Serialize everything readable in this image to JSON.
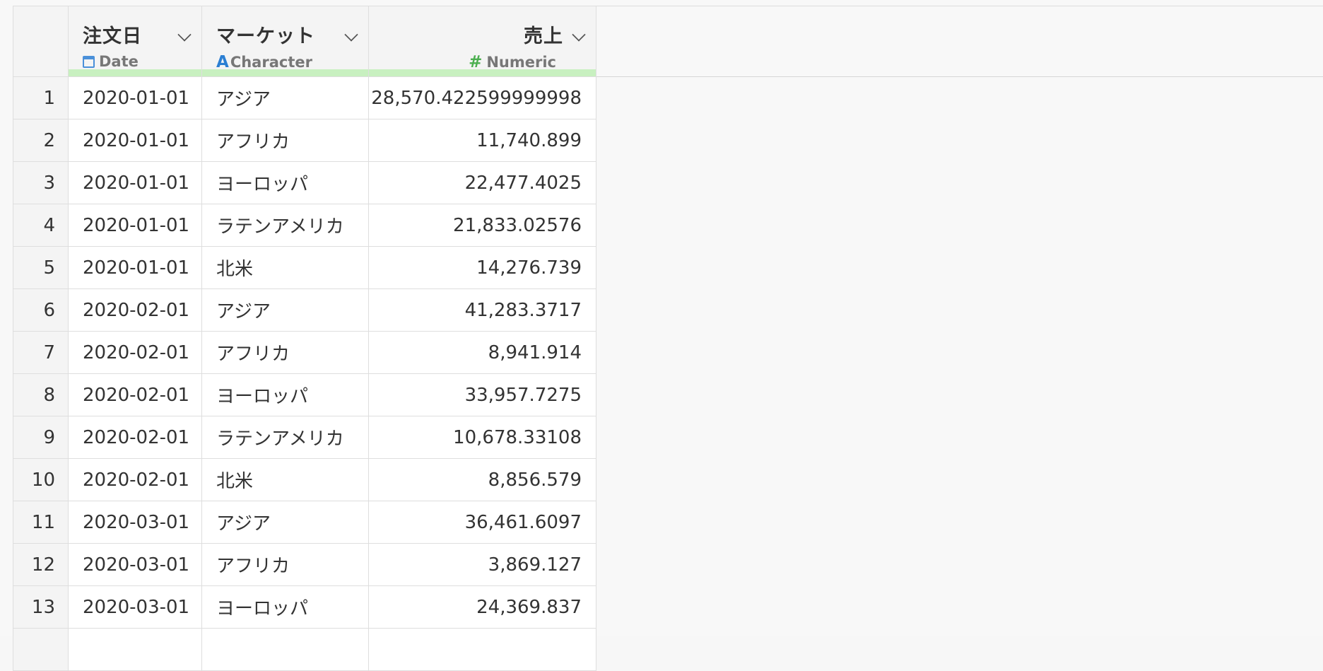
{
  "columns": [
    {
      "name": "注文日",
      "type_label": "Date",
      "type_icon": "calendar-icon"
    },
    {
      "name": "マーケット",
      "type_label": "Character",
      "type_icon": "character-a-icon"
    },
    {
      "name": "売上",
      "type_label": "Numeric",
      "type_icon": "hash-icon"
    }
  ],
  "type_icon_glyphs": {
    "character": "A",
    "numeric": "#"
  },
  "rows": [
    {
      "n": "1",
      "date": "2020-01-01",
      "market": "アジア",
      "sales": "28,570.422599999998"
    },
    {
      "n": "2",
      "date": "2020-01-01",
      "market": "アフリカ",
      "sales": "11,740.899"
    },
    {
      "n": "3",
      "date": "2020-01-01",
      "market": "ヨーロッパ",
      "sales": "22,477.4025"
    },
    {
      "n": "4",
      "date": "2020-01-01",
      "market": "ラテンアメリカ",
      "sales": "21,833.02576"
    },
    {
      "n": "5",
      "date": "2020-01-01",
      "market": "北米",
      "sales": "14,276.739"
    },
    {
      "n": "6",
      "date": "2020-02-01",
      "market": "アジア",
      "sales": "41,283.3717"
    },
    {
      "n": "7",
      "date": "2020-02-01",
      "market": "アフリカ",
      "sales": "8,941.914"
    },
    {
      "n": "8",
      "date": "2020-02-01",
      "market": "ヨーロッパ",
      "sales": "33,957.7275"
    },
    {
      "n": "9",
      "date": "2020-02-01",
      "market": "ラテンアメリカ",
      "sales": "10,678.33108"
    },
    {
      "n": "10",
      "date": "2020-02-01",
      "market": "北米",
      "sales": "8,856.579"
    },
    {
      "n": "11",
      "date": "2020-03-01",
      "market": "アジア",
      "sales": "36,461.6097"
    },
    {
      "n": "12",
      "date": "2020-03-01",
      "market": "アフリカ",
      "sales": "3,869.127"
    },
    {
      "n": "13",
      "date": "2020-03-01",
      "market": "ヨーロッパ",
      "sales": "24,369.837"
    },
    {
      "n": "",
      "date": "",
      "market": "",
      "sales": ""
    }
  ],
  "colors": {
    "date_icon": "#4a90d9",
    "character_icon": "#2b7fd3",
    "numeric_icon": "#4caf50",
    "column_quality_bar": "#c8f0c0"
  }
}
